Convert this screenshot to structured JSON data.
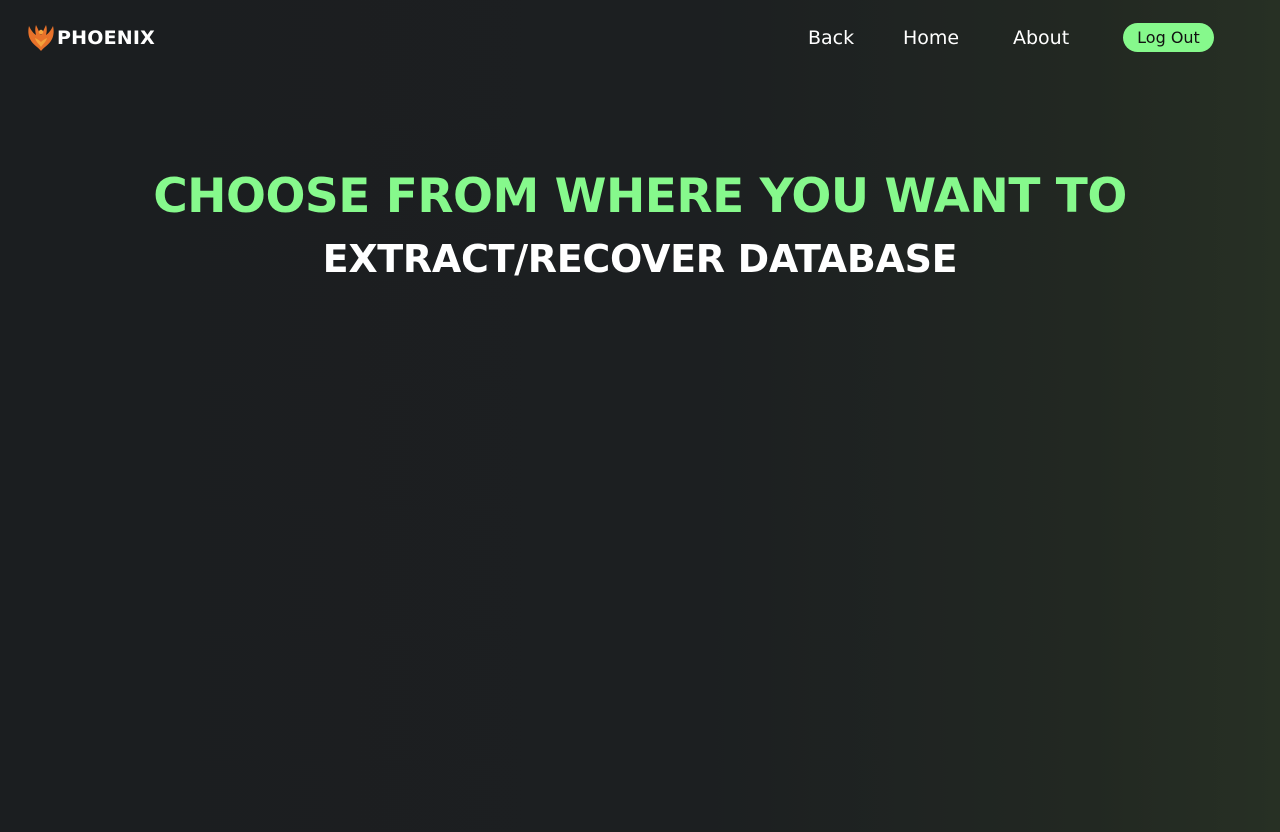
{
  "nav": {
    "brand": {
      "name": "PHOENIX",
      "icon": "phoenix-logo-icon"
    },
    "links": {
      "back": "Back",
      "home": "Home",
      "about": "About"
    },
    "logout_label": "Log Out"
  },
  "main": {
    "headline": "CHOOSE FROM WHERE YOU WANT TO",
    "subheadline": "EXTRACT/RECOVER DATABASE"
  },
  "colors": {
    "accent": "#86f98c",
    "background": "#1b1e20",
    "text": "#ffffff",
    "logo_orange": "#e8722a"
  }
}
